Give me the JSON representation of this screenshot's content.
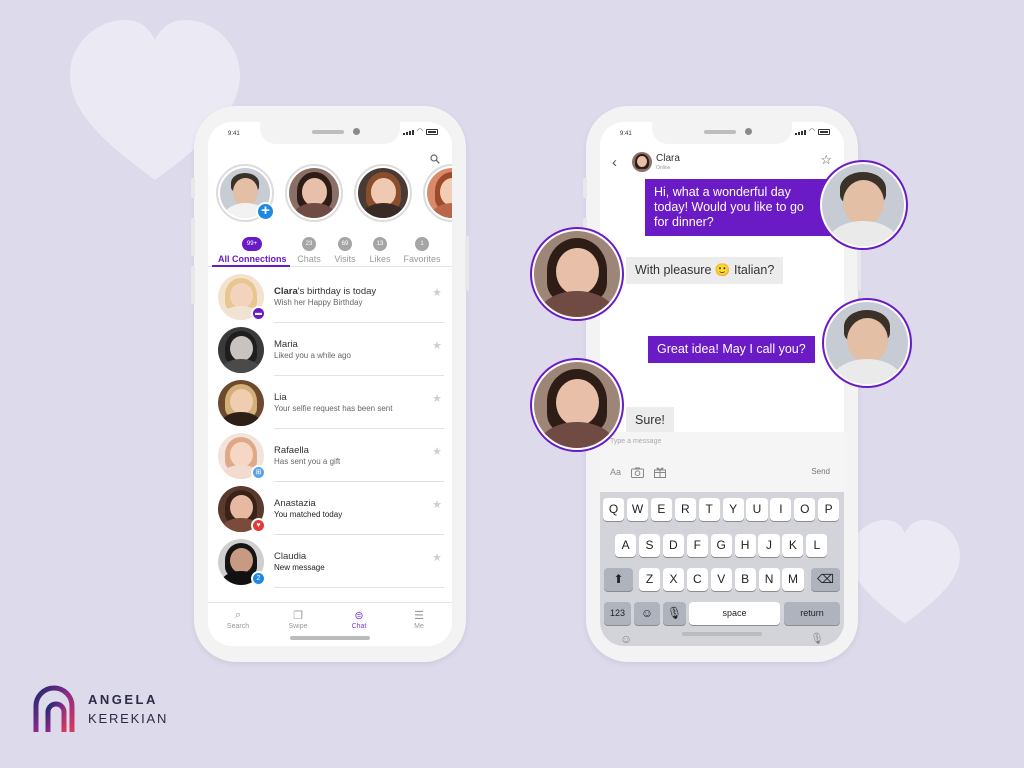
{
  "colors": {
    "accent": "#6a1bc6",
    "background": "#dcdaeb",
    "plus": "#1e88e5"
  },
  "left_phone": {
    "status_time": "9:41",
    "tabs": [
      {
        "count": "99+",
        "label": "All Connections"
      },
      {
        "count": "23",
        "label": "Chats"
      },
      {
        "count": "69",
        "label": "Visits"
      },
      {
        "count": "13",
        "label": "Likes"
      },
      {
        "count": "1",
        "label": "Favorites"
      }
    ],
    "list": [
      {
        "name": "Clara",
        "name_suffix": "'s birthday is today",
        "sub": "Wish her Happy Birthday",
        "badge": "birthday-icon"
      },
      {
        "name": "Maria",
        "sub": "Liked you a while ago"
      },
      {
        "name": "Lia",
        "sub": "Your selfie request has been sent"
      },
      {
        "name": "Rafaella",
        "sub": "Has sent you a gift",
        "badge": "gift-icon"
      },
      {
        "name": "Anastazia",
        "sub": "You matched today",
        "badge": "heart-icon"
      },
      {
        "name": "Claudia",
        "sub": "New message",
        "badge": "2"
      }
    ],
    "nav": [
      {
        "label": "Search",
        "icon": "search-icon"
      },
      {
        "label": "Swipe",
        "icon": "swipe-cards-icon"
      },
      {
        "label": "Chat",
        "icon": "chat-icon"
      },
      {
        "label": "Me",
        "icon": "profile-icon"
      }
    ]
  },
  "right_phone": {
    "status_time": "9:41",
    "contact_name": "Clara",
    "contact_status": "Online",
    "messages": [
      {
        "from": "me",
        "text": "Hi, what a wonderful day today! Would you like to go for dinner?"
      },
      {
        "from": "them",
        "text_a": "With pleasure",
        "emoji": "🙂",
        "text_b": " Italian?"
      },
      {
        "from": "me",
        "text": "Great idea! May I call you?"
      },
      {
        "from": "them",
        "text": "Sure!"
      }
    ],
    "input_placeholder": "Type a message",
    "tool_text": "Aa",
    "send_label": "Send",
    "keyboard": {
      "row1": [
        "Q",
        "W",
        "E",
        "R",
        "T",
        "Y",
        "U",
        "I",
        "O",
        "P"
      ],
      "row2": [
        "A",
        "S",
        "D",
        "F",
        "G",
        "H",
        "J",
        "K",
        "L"
      ],
      "row3": [
        "Z",
        "X",
        "C",
        "V",
        "B",
        "N",
        "M"
      ],
      "numbers_key": "123",
      "space_key": "space",
      "return_key": "return"
    }
  },
  "logo": {
    "line1": "ANGELA",
    "line2": "KEREKIAN"
  }
}
